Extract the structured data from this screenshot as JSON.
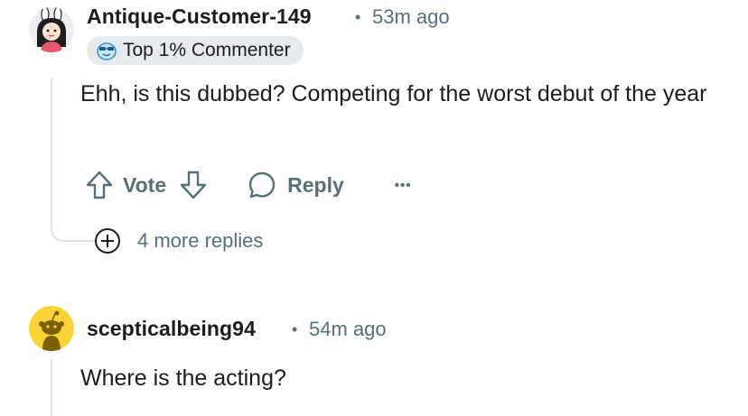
{
  "comments": [
    {
      "username": "Antique-Customer-149",
      "separator": "•",
      "timestamp": "53m ago",
      "avatar_icon": "bunny-girl-avatar-icon",
      "flair": {
        "label": "Top 1% Commenter",
        "icon": "sunglasses-emoji-icon"
      },
      "body": "Ehh, is this dubbed? Competing for the worst debut of the year",
      "actions": {
        "vote_label": "Vote",
        "reply_label": "Reply",
        "more_label": "•••"
      },
      "more_replies_label": "4 more replies"
    },
    {
      "username": "scepticalbeing94",
      "separator": "•",
      "timestamp": "54m ago",
      "avatar_icon": "snoo-default-avatar-icon",
      "body": "Where is the acting?"
    }
  ],
  "colors": {
    "meta_gray": "#576f76",
    "thread_line": "#dfe3e6",
    "flair_bg": "#e5ebee",
    "snoo_yellow": "#fcd234"
  }
}
